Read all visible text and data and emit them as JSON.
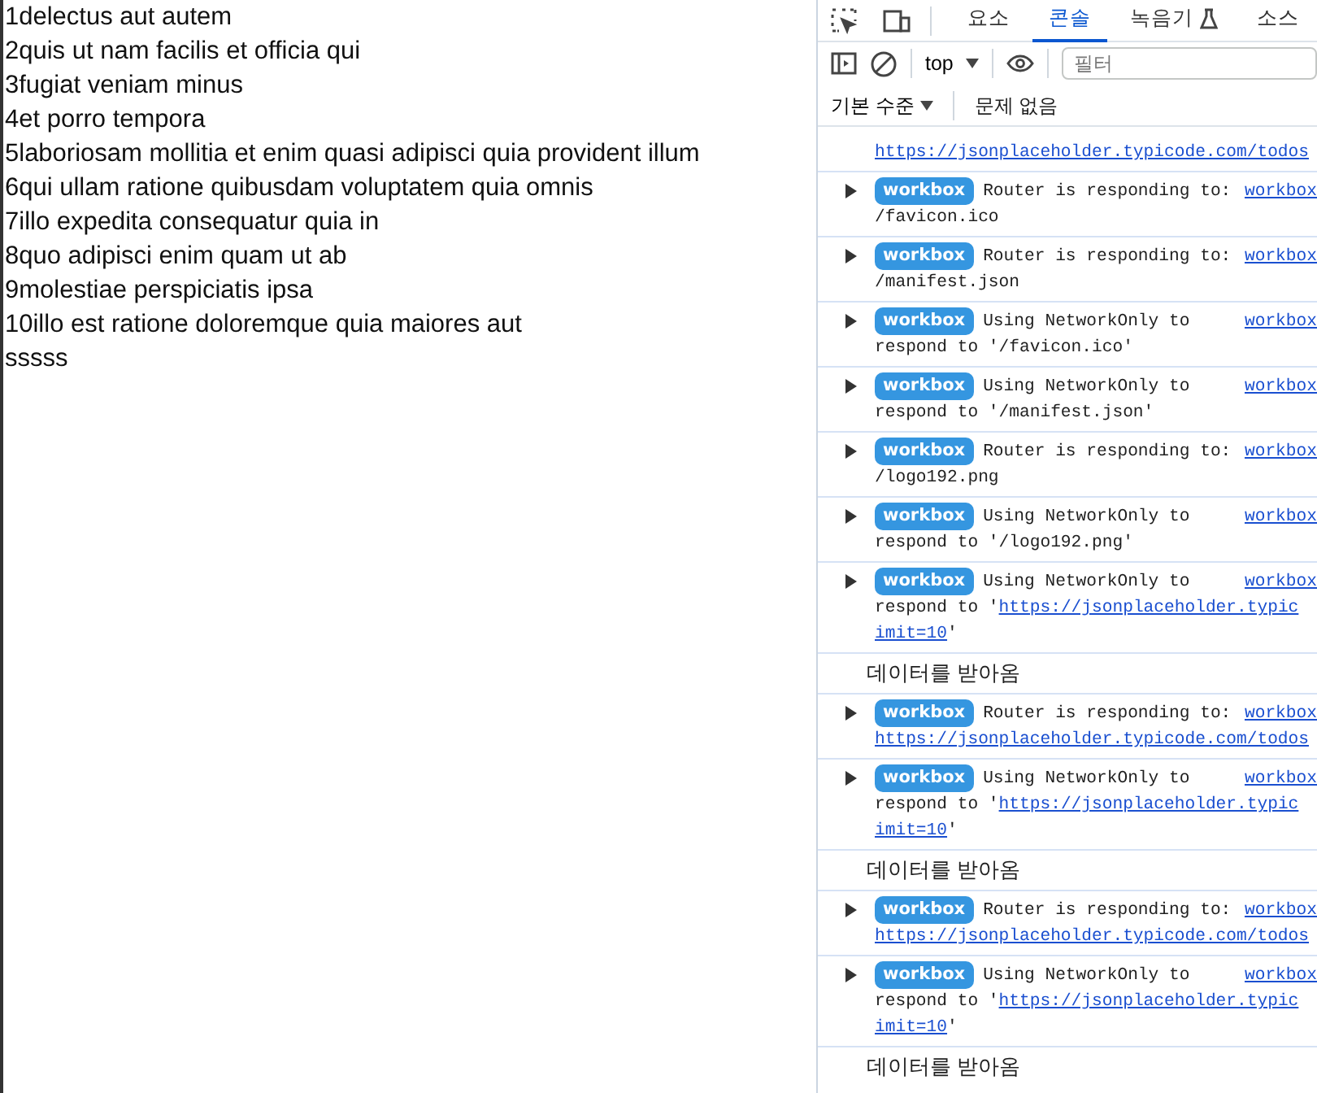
{
  "page": {
    "lines": [
      "1delectus aut autem",
      "2quis ut nam facilis et officia qui",
      "3fugiat veniam minus",
      "4et porro tempora",
      "5laboriosam mollitia et enim quasi adipisci quia provident illum",
      "6qui ullam ratione quibusdam voluptatem quia omnis",
      "7illo expedita consequatur quia in",
      "8quo adipisci enim quam ut ab",
      "9molestiae perspiciatis ipsa",
      "10illo est ratione doloremque quia maiores aut",
      "sssss"
    ]
  },
  "devtools": {
    "tabs": [
      {
        "label": "요소",
        "selected": false,
        "kind": "plain"
      },
      {
        "label": "콘솔",
        "selected": true,
        "kind": "plain"
      },
      {
        "label": "녹음기",
        "selected": false,
        "kind": "experimental"
      },
      {
        "label": "소스",
        "selected": false,
        "kind": "plain"
      }
    ],
    "context": "top",
    "filter": {
      "placeholder": "필터"
    },
    "level": "기본 수준",
    "issues": "문제 없음",
    "messages": [
      {
        "kind": "partial",
        "lines": [
          [
            {
              "text": "https://jsonplaceholder.typicode.com/todos",
              "link": true
            }
          ]
        ]
      },
      {
        "kind": "log",
        "expanded": false,
        "badge": "workbox",
        "text": "Router is responding to:",
        "source": "workbox",
        "lines": [
          [
            {
              "text": "/favicon.ico",
              "link": false
            }
          ]
        ]
      },
      {
        "kind": "log",
        "expanded": false,
        "badge": "workbox",
        "text": "Router is responding to:",
        "source": "workbox",
        "lines": [
          [
            {
              "text": "/manifest.json",
              "link": false
            }
          ]
        ]
      },
      {
        "kind": "log",
        "expanded": false,
        "badge": "workbox",
        "text": "Using NetworkOnly to",
        "source": "workbox",
        "lines": [
          [
            {
              "text": "respond to '/favicon.ico'",
              "link": false
            }
          ]
        ]
      },
      {
        "kind": "log",
        "expanded": false,
        "badge": "workbox",
        "text": "Using NetworkOnly to",
        "source": "workbox",
        "lines": [
          [
            {
              "text": "respond to '/manifest.json'",
              "link": false
            }
          ]
        ]
      },
      {
        "kind": "log",
        "expanded": false,
        "badge": "workbox",
        "text": "Router is responding to:",
        "source": "workbox",
        "lines": [
          [
            {
              "text": "/logo192.png",
              "link": false
            }
          ]
        ]
      },
      {
        "kind": "log",
        "expanded": false,
        "badge": "workbox",
        "text": "Using NetworkOnly to",
        "source": "workbox",
        "lines": [
          [
            {
              "text": "respond to '/logo192.png'",
              "link": false
            }
          ]
        ]
      },
      {
        "kind": "log",
        "expanded": false,
        "badge": "workbox",
        "text": "Using NetworkOnly to",
        "source": "workbox",
        "lines": [
          [
            {
              "text": "respond to '",
              "link": false
            },
            {
              "text": "https://jsonplaceholder.typic",
              "link": true
            }
          ],
          [
            {
              "text": "imit=10",
              "link": true
            },
            {
              "text": "'",
              "link": false
            }
          ]
        ]
      },
      {
        "kind": "text",
        "text": "데이터를 받아옴"
      },
      {
        "kind": "log",
        "expanded": false,
        "badge": "workbox",
        "text": "Router is responding to:",
        "source": "workbox",
        "lines": [
          [
            {
              "text": "https://jsonplaceholder.typicode.com/todos",
              "link": true
            }
          ]
        ]
      },
      {
        "kind": "log",
        "expanded": false,
        "badge": "workbox",
        "text": "Using NetworkOnly to",
        "source": "workbox",
        "lines": [
          [
            {
              "text": "respond to '",
              "link": false
            },
            {
              "text": "https://jsonplaceholder.typic",
              "link": true
            }
          ],
          [
            {
              "text": "imit=10",
              "link": true
            },
            {
              "text": "'",
              "link": false
            }
          ]
        ]
      },
      {
        "kind": "text",
        "text": "데이터를 받아옴"
      },
      {
        "kind": "log",
        "expanded": false,
        "badge": "workbox",
        "text": "Router is responding to:",
        "source": "workbox",
        "lines": [
          [
            {
              "text": "https://jsonplaceholder.typicode.com/todos",
              "link": true
            }
          ]
        ]
      },
      {
        "kind": "log",
        "expanded": false,
        "badge": "workbox",
        "text": "Using NetworkOnly to",
        "source": "workbox",
        "lines": [
          [
            {
              "text": "respond to '",
              "link": false
            },
            {
              "text": "https://jsonplaceholder.typic",
              "link": true
            }
          ],
          [
            {
              "text": "imit=10",
              "link": true
            },
            {
              "text": "'",
              "link": false
            }
          ]
        ]
      },
      {
        "kind": "text",
        "text": "데이터를 받아옴"
      }
    ]
  }
}
